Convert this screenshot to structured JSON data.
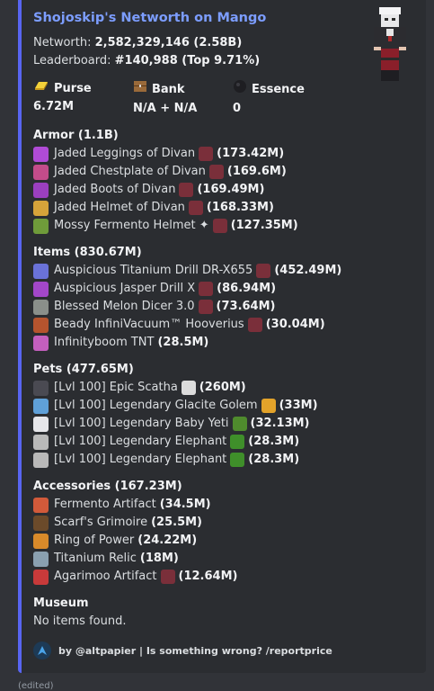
{
  "title": "Shojoskip's Networth on Mango",
  "networth": {
    "label": "Networth:",
    "value": "2,582,329,146 (2.58B)"
  },
  "leaderboard": {
    "label": "Leaderboard:",
    "value": "#140,988 (Top 9.71%)"
  },
  "fields": [
    {
      "name": "Purse",
      "value": "6.72M",
      "icon": "gold-ingot-icon"
    },
    {
      "name": "Bank",
      "value": "N/A + N/A",
      "icon": "bank-chest-icon"
    },
    {
      "name": "Essence",
      "value": "0",
      "icon": "wither-essence-icon"
    }
  ],
  "armor": {
    "title": "Armor (1.1B)",
    "items": [
      {
        "name": "Jaded Leggings of Divan",
        "value": "(173.42M)",
        "icon": "#b04bd6"
      },
      {
        "name": "Jaded Chestplate of Divan",
        "value": "(169.6M)",
        "icon": "#c34c8a"
      },
      {
        "name": "Jaded Boots of Divan",
        "value": "(169.49M)",
        "icon": "#9b3fbf"
      },
      {
        "name": "Jaded Helmet of Divan",
        "value": "(168.33M)",
        "icon": "#d6a33a"
      },
      {
        "name": "Mossy Fermento Helmet ✦",
        "value": "(127.35M)",
        "icon": "#6f9b3a"
      }
    ]
  },
  "items_section": {
    "title": "Items (830.67M)",
    "items": [
      {
        "name": "Auspicious Titanium Drill DR-X655",
        "value": "(452.49M)",
        "icon": "#6a72d8"
      },
      {
        "name": "Auspicious Jasper Drill X",
        "value": "(86.94M)",
        "icon": "#a347c9"
      },
      {
        "name": "Blessed Melon Dicer 3.0",
        "value": "(73.64M)",
        "icon": "#8a8f8a"
      },
      {
        "name": "Beady InfiniVacuum™ Hooverius",
        "value": "(30.04M)",
        "icon": "#b5542e"
      },
      {
        "name": "Infinityboom TNT",
        "value": "(28.5M)",
        "icon": "#c45fbe",
        "no_recomb": true
      }
    ]
  },
  "pets": {
    "title": "Pets (477.65M)",
    "items": [
      {
        "name": "[Lvl 100] Epic Scatha",
        "value": "(260M)",
        "icon": "#4a4a52",
        "extra": "#dcdcdc"
      },
      {
        "name": "[Lvl 100] Legendary Glacite Golem",
        "value": "(33M)",
        "icon": "#5fa0d8",
        "extra": "#e3a32a"
      },
      {
        "name": "[Lvl 100] Legendary Baby Yeti",
        "value": "(32.13M)",
        "icon": "#e6e6ea",
        "extra": "#4f8b2d"
      },
      {
        "name": "[Lvl 100] Legendary Elephant",
        "value": "(28.3M)",
        "icon": "#b9b9b9",
        "extra": "#3f8f2a"
      },
      {
        "name": "[Lvl 100] Legendary Elephant",
        "value": "(28.3M)",
        "icon": "#b9b9b9",
        "extra": "#3f8f2a"
      }
    ]
  },
  "accessories": {
    "title": "Accessories (167.23M)",
    "items": [
      {
        "name": "Fermento Artifact",
        "value": "(34.5M)",
        "icon": "#d25a3a",
        "no_recomb": true
      },
      {
        "name": "Scarf's Grimoire",
        "value": "(25.5M)",
        "icon": "#6b4a2a",
        "no_recomb": true
      },
      {
        "name": "Ring of Power",
        "value": "(24.22M)",
        "icon": "#d88a2a",
        "no_recomb": true
      },
      {
        "name": "Titanium Relic",
        "value": "(18M)",
        "icon": "#8aa0b0",
        "no_recomb": true
      },
      {
        "name": "Agarimoo Artifact",
        "value": "(12.64M)",
        "icon": "#c83a3a"
      }
    ]
  },
  "museum": {
    "title": "Museum",
    "text": "No items found."
  },
  "footer": {
    "text": "by @altpapier | Is something wrong? /reportprice"
  },
  "edited": "(edited)",
  "colors": {
    "accent": "#5865f2",
    "title": "#7c9dff",
    "background": "#313338",
    "embed": "#2b2d31"
  }
}
